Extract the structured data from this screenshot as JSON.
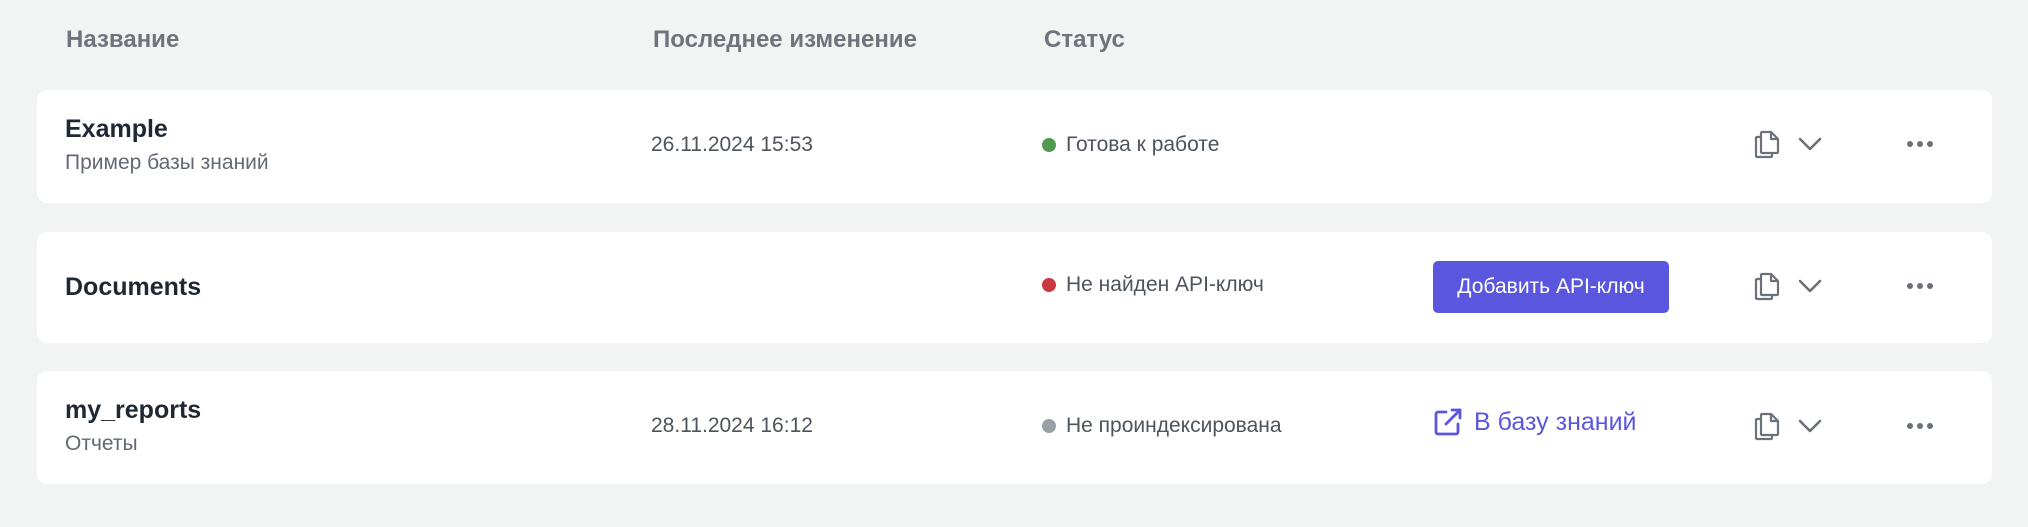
{
  "columns": {
    "name": "Название",
    "modified": "Последнее изменение",
    "status": "Статус"
  },
  "colors": {
    "accent": "#5b56de",
    "status_ready": "#4f9a4f",
    "status_error": "#c9393f",
    "status_not_indexed": "#9ba0a6"
  },
  "rows": [
    {
      "title": "Example",
      "subtitle": "Пример базы знаний",
      "modified": "26.11.2024 15:53",
      "status": "Готова к работе",
      "status_color": "#4f9a4f"
    },
    {
      "title": "Documents",
      "subtitle": "",
      "modified": "",
      "status": "Не найден API-ключ",
      "status_color": "#c9393f",
      "action_label": "Добавить API-ключ"
    },
    {
      "title": "my_reports",
      "subtitle": "Отчеты",
      "modified": "28.11.2024 16:12",
      "status": "Не проиндексирована",
      "status_color": "#9ba0a6",
      "action_label": "В базу знаний",
      "action_icon": "external-link-icon"
    }
  ],
  "row_icons": [
    "copy-icon",
    "chevron-down-icon",
    "more-horizontal-icon"
  ]
}
